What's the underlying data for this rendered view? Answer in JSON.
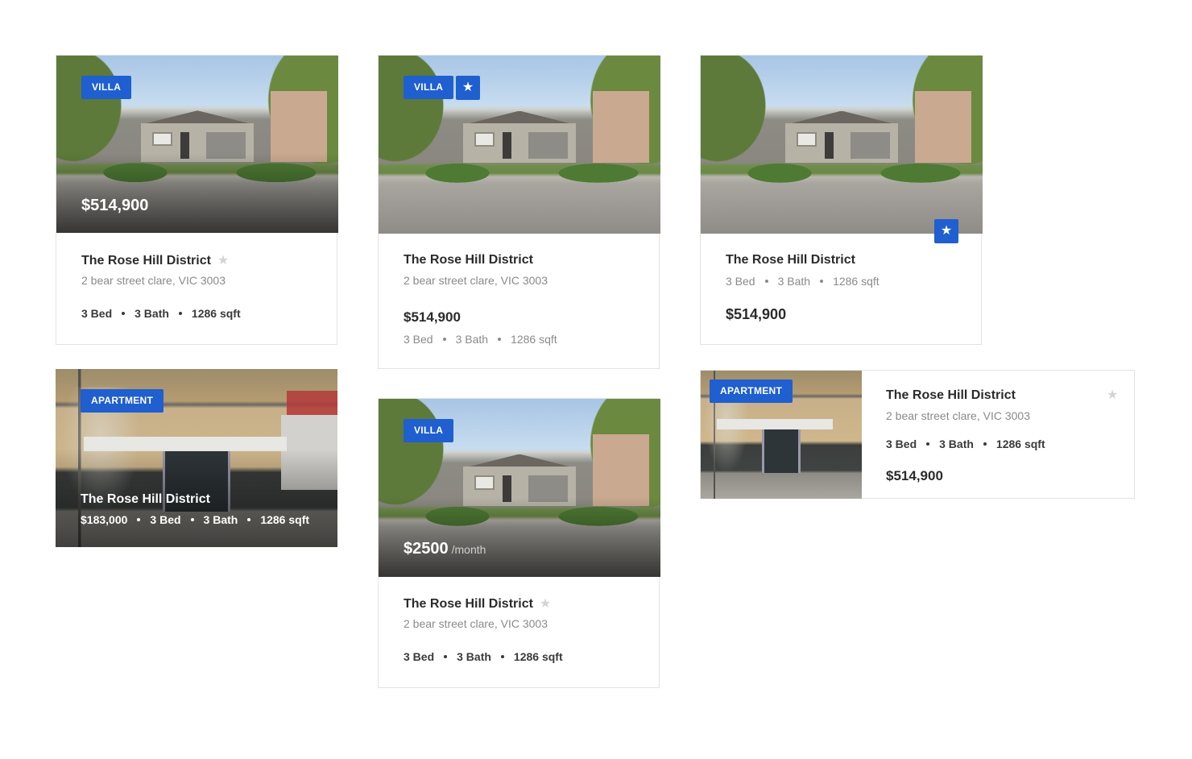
{
  "colors": {
    "accent": "#1f5fcf",
    "text": "#2b2b2b",
    "muted": "#8a8a8a",
    "border": "#e3e3e3"
  },
  "icons": {
    "favorite": "star-icon"
  },
  "cards": [
    {
      "badge": "VILLA",
      "price": "$514,900",
      "title": "The Rose Hill District",
      "address": "2 bear street clare, VIC 3003",
      "beds": "3 Bed",
      "baths": "3 Bath",
      "area": "1286 sqft",
      "favorite": false
    },
    {
      "badge": "VILLA",
      "price": "$514,900",
      "title": "The Rose Hill District",
      "address": "2 bear street clare, VIC 3003",
      "beds": "3 Bed",
      "baths": "3 Bath",
      "area": "1286 sqft",
      "favorite": true
    },
    {
      "price": "$514,900",
      "title": "The Rose Hill District",
      "beds": "3 Bed",
      "baths": "3 Bath",
      "area": "1286 sqft",
      "favorite": true
    },
    {
      "badge": "APARTMENT",
      "price": "$183,000",
      "title": "The Rose Hill District",
      "beds": "3 Bed",
      "baths": "3 Bath",
      "area": "1286 sqft"
    },
    {
      "badge": "VILLA",
      "price": "$2500",
      "price_suffix": "/month",
      "title": "The Rose Hill District",
      "address": "2 bear street clare, VIC 3003",
      "beds": "3 Bed",
      "baths": "3 Bath",
      "area": "1286 sqft",
      "favorite": false
    },
    {
      "badge": "APARTMENT",
      "price": "$514,900",
      "title": "The Rose Hill District",
      "address": "2 bear street clare, VIC 3003",
      "beds": "3 Bed",
      "baths": "3 Bath",
      "area": "1286 sqft",
      "favorite": false
    }
  ],
  "star_glyph": "★"
}
